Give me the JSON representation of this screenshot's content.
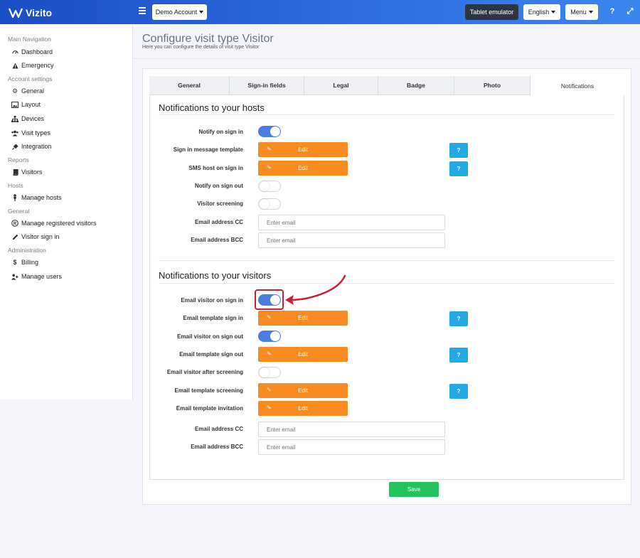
{
  "brand": {
    "name": "Vizito"
  },
  "topbar": {
    "account_label": "Demo Account",
    "tablet_label": "Tablet emulator",
    "language_label": "English",
    "menu_label": "Menu",
    "help_glyph": "?",
    "expand_glyph": "⤢"
  },
  "sidebar": {
    "sections": [
      {
        "title": "Main Navigation",
        "items": [
          {
            "label": "Dashboard",
            "icon": "gauge-icon"
          },
          {
            "label": "Emergency",
            "icon": "warning-icon"
          }
        ]
      },
      {
        "title": "Account settings",
        "items": [
          {
            "label": "General",
            "icon": "gear-icon"
          },
          {
            "label": "Layout",
            "icon": "image-icon"
          },
          {
            "label": "Devices",
            "icon": "sitemap-icon"
          },
          {
            "label": "Visit types",
            "icon": "users-icon"
          },
          {
            "label": "Integration",
            "icon": "plug-icon"
          }
        ]
      },
      {
        "title": "Reports",
        "items": [
          {
            "label": "Visitors",
            "icon": "book-icon"
          }
        ]
      },
      {
        "title": "Hosts",
        "items": [
          {
            "label": "Manage hosts",
            "icon": "person-icon"
          }
        ]
      },
      {
        "title": "General",
        "items": [
          {
            "label": "Manage registered visitors",
            "icon": "registered-icon"
          },
          {
            "label": "Visitor sign in",
            "icon": "pencil-icon"
          }
        ]
      },
      {
        "title": "Administration",
        "items": [
          {
            "label": "Billing",
            "icon": "dollar-icon"
          },
          {
            "label": "Manage users",
            "icon": "user-plus-icon"
          }
        ]
      }
    ]
  },
  "header": {
    "title": "Configure visit type Visitor",
    "subtitle": "Here you can configure the details of visit type Visitor"
  },
  "tabs": [
    {
      "label": "General"
    },
    {
      "label": "Sign-in fields"
    },
    {
      "label": "Legal"
    },
    {
      "label": "Badge"
    },
    {
      "label": "Photo"
    },
    {
      "label": "Notifications",
      "active": true
    }
  ],
  "hosts_section": {
    "title": "Notifications to your hosts",
    "rows": {
      "notify_sign_in": {
        "label": "Notify on sign in",
        "on": true
      },
      "sign_in_template": {
        "label": "Sign in message template",
        "button": "Edit"
      },
      "sms_sign_in": {
        "label": "SMS host on sign in",
        "button": "Edit"
      },
      "notify_sign_out": {
        "label": "Notify on sign out",
        "on": false
      },
      "visitor_screening": {
        "label": "Visitor screening",
        "on": false
      },
      "email_cc": {
        "label": "Email address CC",
        "placeholder": "Enter email"
      },
      "email_bcc": {
        "label": "Email address BCC",
        "placeholder": "Enter email"
      }
    }
  },
  "visitors_section": {
    "title": "Notifications to your visitors",
    "rows": {
      "email_sign_in": {
        "label": "Email visitor on sign in",
        "on": true
      },
      "template_sign_in": {
        "label": "Email template sign in",
        "button": "Edit"
      },
      "email_sign_out": {
        "label": "Email visitor on sign out",
        "on": true
      },
      "template_sign_out": {
        "label": "Email template sign out",
        "button": "Edit"
      },
      "email_after_screening": {
        "label": "Email visitor after screening",
        "on": false
      },
      "template_screening": {
        "label": "Email template screening",
        "button": "Edit"
      },
      "template_invitation": {
        "label": "Email template invitation",
        "button": "Edit"
      },
      "email_cc": {
        "label": "Email address CC",
        "placeholder": "Enter email"
      },
      "email_bcc": {
        "label": "Email address BCC",
        "placeholder": "Enter email"
      }
    }
  },
  "help_label": "?",
  "save_label": "Save",
  "colors": {
    "topbar_start": "#1a4ec4",
    "topbar_end": "#3a86ee",
    "toggle_on": "#4a7fdb",
    "edit_button": "#f88b1f",
    "help_button": "#24a9e6",
    "save_button": "#22c25c",
    "highlight": "#cc1f36"
  }
}
